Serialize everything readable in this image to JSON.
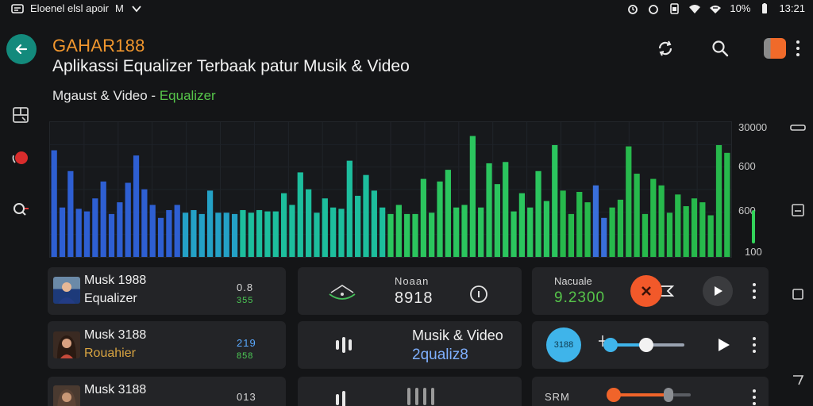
{
  "status_bar": {
    "left_text": "Eloenel elsl apoir",
    "left_letter": "M",
    "battery_text": "10%",
    "time": "13:21"
  },
  "header": {
    "app_name": "GAHAR188",
    "subtitle": "Aplikassi Equalizer Terbaak patur Musik & Video",
    "breadcrumb_main": "Mgaust & Video - ",
    "breadcrumb_accent": "Equalizer"
  },
  "icons": {
    "back": "back-arrow-icon",
    "sync": "sync-icon",
    "search": "search-icon",
    "menu": "more-vert-icon"
  },
  "colors": {
    "accent_orange": "#f0962e",
    "accent_green": "#56c54a",
    "back_teal": "#138a7c",
    "card_bg": "#232427"
  },
  "visualizer": {
    "y_labels": [
      "30000",
      "600",
      "600",
      "100"
    ],
    "levels": [
      0.82,
      0.38,
      0.66,
      0.37,
      0.35,
      0.45,
      0.58,
      0.33,
      0.42,
      0.57,
      0.78,
      0.52,
      0.4,
      0.3,
      0.36,
      0.4,
      0.34,
      0.36,
      0.33,
      0.51,
      0.34,
      0.34,
      0.33,
      0.36,
      0.34,
      0.36,
      0.35,
      0.35,
      0.49,
      0.4,
      0.65,
      0.52,
      0.34,
      0.45,
      0.38,
      0.37,
      0.74,
      0.47,
      0.63,
      0.51,
      0.38,
      0.33,
      0.4,
      0.33,
      0.33,
      0.6,
      0.34,
      0.58,
      0.67,
      0.38,
      0.4,
      0.93,
      0.38,
      0.72,
      0.56,
      0.73,
      0.35,
      0.49,
      0.38,
      0.66,
      0.43,
      0.86,
      0.51,
      0.33,
      0.5,
      0.42,
      0.55,
      0.3,
      0.38,
      0.44,
      0.85,
      0.64,
      0.33,
      0.6,
      0.55,
      0.34,
      0.48,
      0.39,
      0.45,
      0.42,
      0.32,
      0.86,
      0.8
    ]
  },
  "tracks": [
    {
      "title": "Musk 1988",
      "subtitle": "Equalizer",
      "value_top": "0.8",
      "value_bottom": "355",
      "center_label": "Noaan",
      "center_number": "8918",
      "right_label": "Nacuale",
      "right_number": "9.2300"
    },
    {
      "title": "Musk 3188",
      "subtitle": "Rouahier",
      "value_top": "219",
      "value_bottom": "858",
      "center_title": "Musik & Video",
      "center_sub": "2qualiz8",
      "badge": "3188",
      "slider_level": 0.5
    },
    {
      "title": "Musk 3188",
      "value_top": "013",
      "right_label": "SRM",
      "slider_level": 0.72
    }
  ]
}
